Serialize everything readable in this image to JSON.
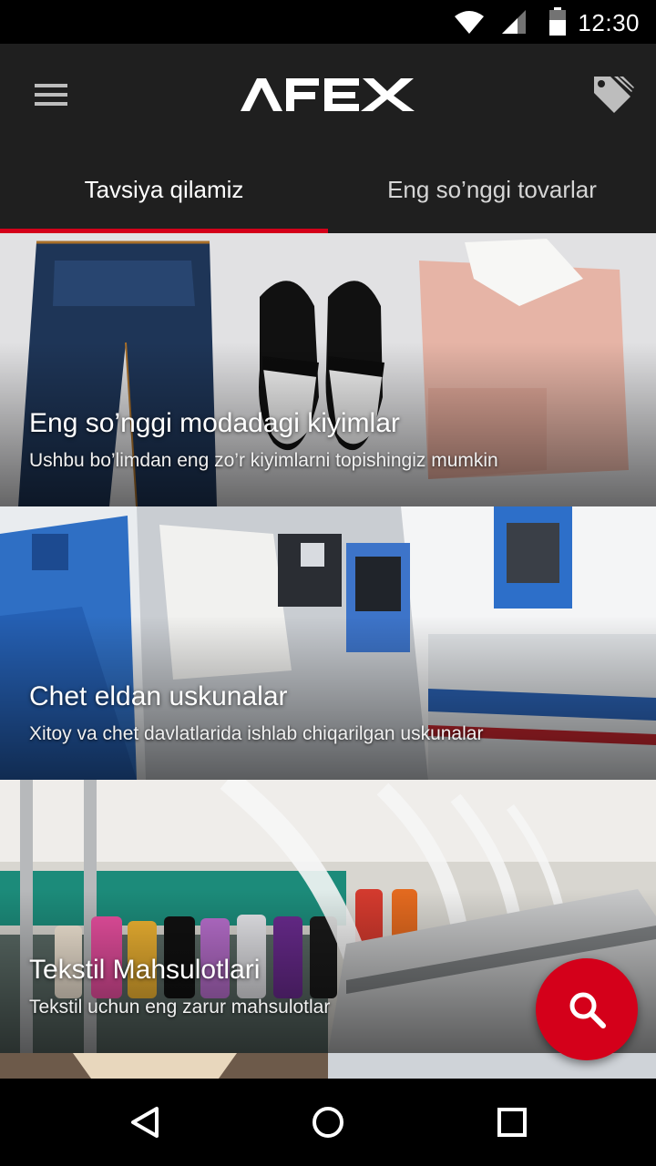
{
  "status_bar": {
    "time": "12:30",
    "icons": [
      "wifi-icon",
      "signal-icon",
      "battery-icon"
    ]
  },
  "toolbar": {
    "logo_text": "AFEX",
    "menu_icon": "hamburger-menu-icon",
    "action_icon": "tags-icon"
  },
  "tabs": [
    {
      "label": "Tavsiya qilamiz",
      "active": true
    },
    {
      "label": "Eng so’nggi tovarlar",
      "active": false
    }
  ],
  "cards": [
    {
      "title": "Eng so’nggi modadagi kiyimlar",
      "subtitle": "Ushbu bo’limdan eng zo’r kiyimlarni topishingiz mumkin"
    },
    {
      "title": "Chet eldan uskunalar",
      "subtitle": "Xitoy va chet davlatlarida ishlab chiqarilgan uskunalar"
    },
    {
      "title": "Tekstil Mahsulotlari",
      "subtitle": "Tekstil uchun eng zarur mahsulotlar"
    }
  ],
  "fab": {
    "icon": "search-icon"
  },
  "nav_bar": {
    "icons": [
      "back-icon",
      "home-icon",
      "recents-icon"
    ]
  },
  "colors": {
    "accent": "#d4001a",
    "toolbar_bg": "#1f1f1f",
    "status_bg": "#000000"
  }
}
